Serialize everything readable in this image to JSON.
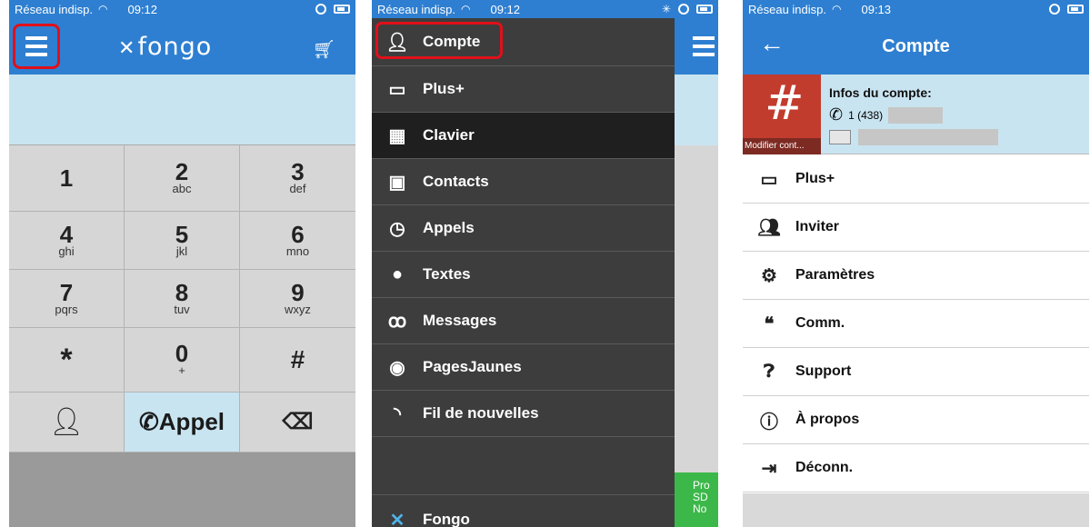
{
  "phone1": {
    "status": {
      "carrier": "Réseau indisp.",
      "time": "09:12"
    },
    "brand": "fongo",
    "call_label": "Appel",
    "keys": [
      {
        "digit": "1",
        "letters": ""
      },
      {
        "digit": "2",
        "letters": "abc"
      },
      {
        "digit": "3",
        "letters": "def"
      },
      {
        "digit": "4",
        "letters": "ghi"
      },
      {
        "digit": "5",
        "letters": "jkl"
      },
      {
        "digit": "6",
        "letters": "mno"
      },
      {
        "digit": "7",
        "letters": "pqrs"
      },
      {
        "digit": "8",
        "letters": "tuv"
      },
      {
        "digit": "9",
        "letters": "wxyz"
      },
      {
        "digit": "*",
        "letters": ""
      },
      {
        "digit": "0",
        "letters": "+"
      },
      {
        "digit": "#",
        "letters": ""
      }
    ]
  },
  "phone2": {
    "status": {
      "carrier": "Réseau indisp.",
      "time": "09:12"
    },
    "menu": [
      {
        "label": "Compte",
        "icon": "person-icon"
      },
      {
        "label": "Plus+",
        "icon": "store-icon"
      },
      {
        "label": "Clavier",
        "icon": "keypad-icon"
      },
      {
        "label": "Contacts",
        "icon": "contacts-icon"
      },
      {
        "label": "Appels",
        "icon": "clock-icon"
      },
      {
        "label": "Textes",
        "icon": "chat-bubble-icon"
      },
      {
        "label": "Messages",
        "icon": "voicemail-icon"
      },
      {
        "label": "PagesJaunes",
        "icon": "pagesjaunes-icon"
      },
      {
        "label": "Fil de nouvelles",
        "icon": "rss-icon"
      }
    ],
    "bottom_label": "Fongo",
    "ad_text": "Pro SD No"
  },
  "phone3": {
    "status": {
      "carrier": "Réseau indisp.",
      "time": "09:13"
    },
    "title": "Compte",
    "account": {
      "info_title": "Infos du compte:",
      "phone_prefix": "1 (438)",
      "modify_label": "Modifier cont..."
    },
    "items": [
      {
        "label": "Plus+",
        "icon": "store-icon"
      },
      {
        "label": "Inviter",
        "icon": "people-icon"
      },
      {
        "label": "Paramètres",
        "icon": "gears-icon"
      },
      {
        "label": "Comm.",
        "icon": "thumbs-icon"
      },
      {
        "label": "Support",
        "icon": "question-icon"
      },
      {
        "label": "À propos",
        "icon": "info-icon"
      },
      {
        "label": "Déconn.",
        "icon": "logout-icon"
      }
    ]
  }
}
